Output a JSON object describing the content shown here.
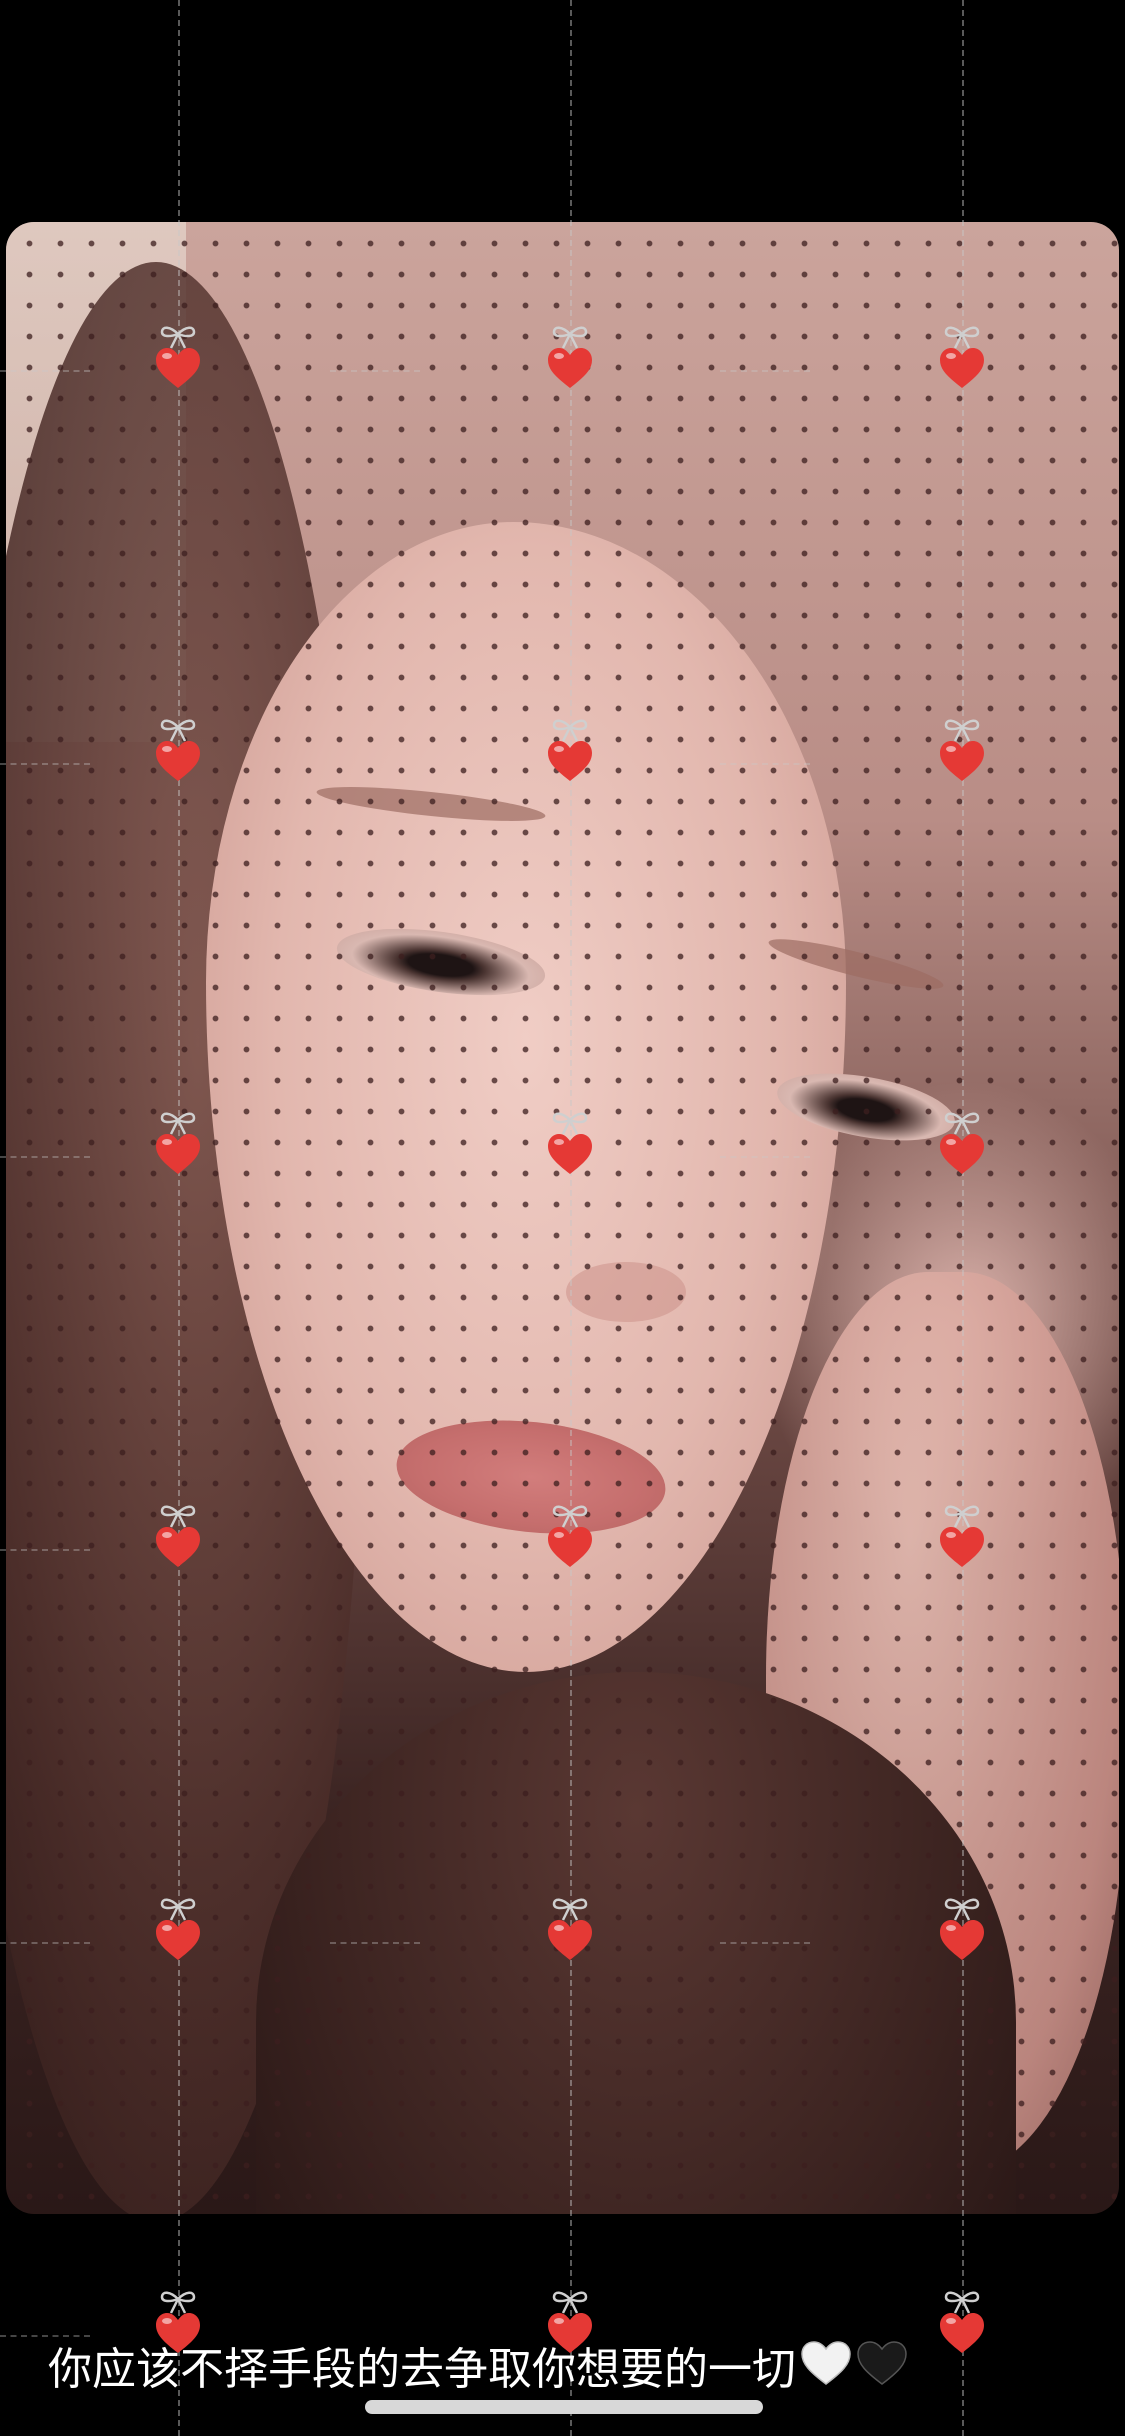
{
  "caption": {
    "text": "你应该不择手段的去争取你想要的一切",
    "emoji": [
      "white-heart",
      "black-heart"
    ]
  },
  "wallpaper": {
    "ornament_icon": "cherry-heart-icon",
    "accent": "#e53935",
    "ribbon": "#cfcfcf"
  },
  "colors": {
    "background": "#000000",
    "caption_text": "#ffffff",
    "home_indicator": "#d8d8d8"
  }
}
